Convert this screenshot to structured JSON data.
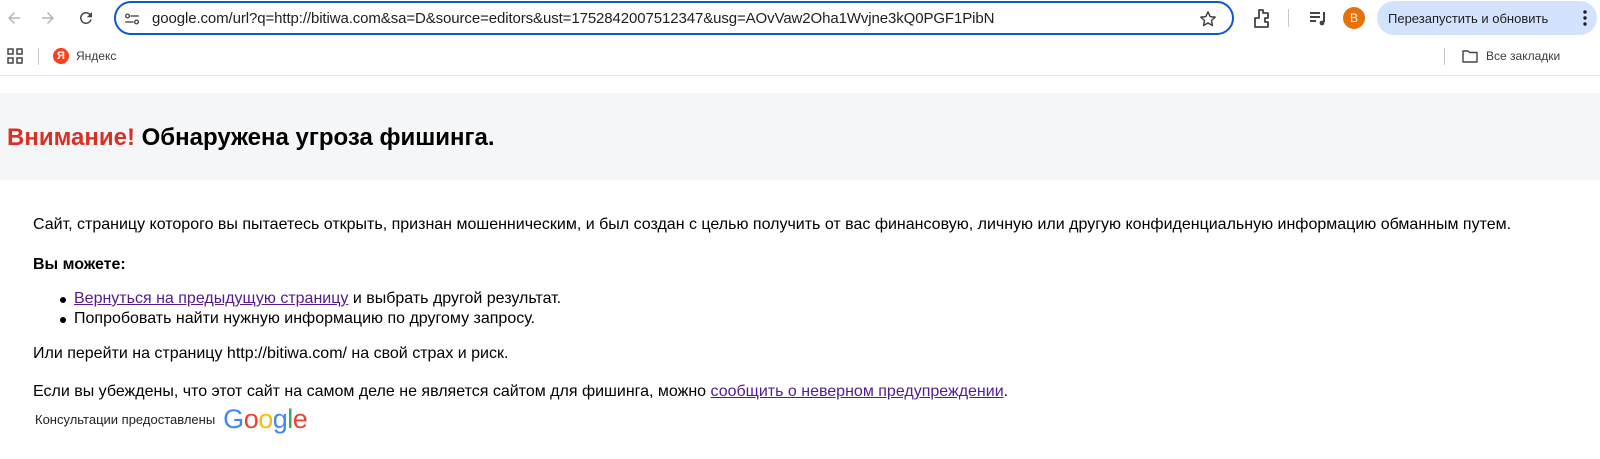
{
  "browser": {
    "url": "google.com/url?q=http://bitiwa.com&sa=D&source=editors&ust=1752842007512347&usg=AOvVaw2Oha1Wvjne3kQ0PGF1PibN",
    "avatar_letter": "B",
    "relaunch_label": "Перезапустить и обновить",
    "icons": [
      "back-icon",
      "forward-icon",
      "reload-icon",
      "site-info-icon",
      "star-icon",
      "extensions-icon",
      "media-icon",
      "kebab-menu-icon"
    ],
    "accent_color": "#0b57d0"
  },
  "bookmarks": {
    "items": [
      {
        "label": "Яндекс",
        "icon": "yandex-icon"
      }
    ],
    "all_bookmarks_label": "Все закладки"
  },
  "page": {
    "title_attention": "Внимание!",
    "title_rest": " Обнаружена угроза фишинга.",
    "title_attention_color": "#d93025",
    "description": "Сайт, страницу которого вы пытаетесь открыть, признан мошенническим, и был создан с целью получить от вас финансовую, личную или другую конфиденциальную информацию обманным путем.",
    "you_can": "Вы можете:",
    "options": {
      "back_link": "Вернуться на предыдущую страницу",
      "back_rest": " и выбрать другой результат.",
      "search_other": "Попробовать найти нужную информацию по другому запросу."
    },
    "proceed_text": "Или перейти на страницу http://bitiwa.com/ на свой страх и риск.",
    "report_prefix": "Если вы убеждены, что этот сайт на самом деле не является сайтом для фишинга, можно ",
    "report_link": "сообщить о неверном предупреждении",
    "report_suffix": ".",
    "provided_by": "Консультации предоставлены",
    "google_logo_text": "Google"
  }
}
